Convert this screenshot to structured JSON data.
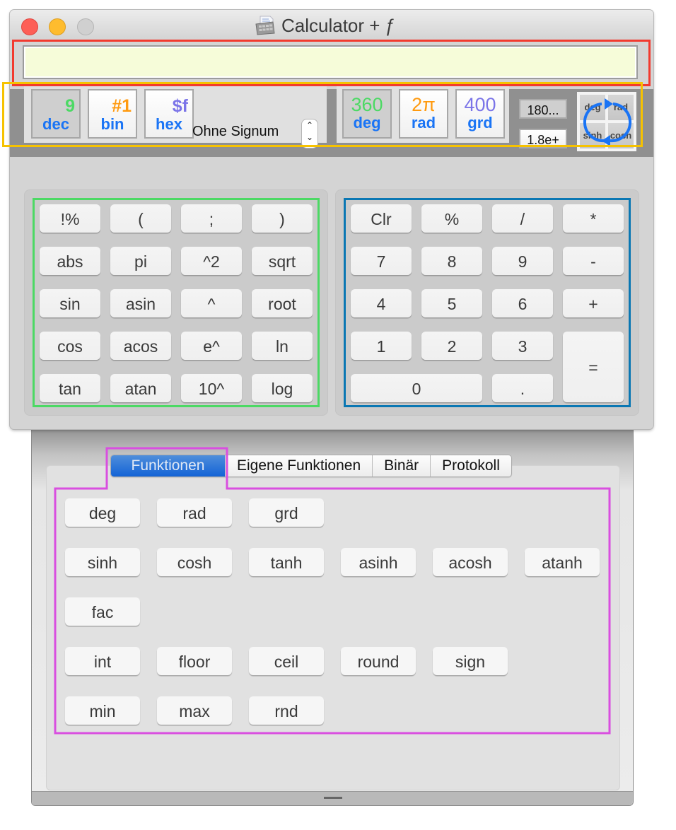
{
  "window": {
    "title": "Calculator + ƒ",
    "traffic_lights": [
      "close",
      "minimize",
      "zoom"
    ]
  },
  "display": {
    "value": ""
  },
  "number_modes": [
    {
      "id": "dec",
      "top": "9",
      "label": "dec",
      "top_color": "#4cd964",
      "selected": true
    },
    {
      "id": "bin",
      "top": "#1",
      "label": "bin",
      "top_color": "#ff9a0f",
      "selected": false
    },
    {
      "id": "hex",
      "top": "$f",
      "label": "hex",
      "top_color": "#7b74e8",
      "selected": false
    }
  ],
  "signum": {
    "selected": "Ohne Signum"
  },
  "angle_modes": [
    {
      "id": "deg",
      "top": "360",
      "label": "deg",
      "top_color": "#4cd964",
      "selected": true
    },
    {
      "id": "rad",
      "top": "2π",
      "label": "rad",
      "top_color": "#ff9a0f",
      "selected": false
    },
    {
      "id": "grd",
      "top": "400",
      "label": "grd",
      "top_color": "#7b74e8",
      "selected": false
    }
  ],
  "format_buttons": [
    {
      "id": "fixed",
      "label": "180...",
      "selected": true
    },
    {
      "id": "scientific",
      "label": "1.8e+",
      "selected": false
    }
  ],
  "rotate_buttons": {
    "labels": [
      "deg",
      "rad",
      "sinh",
      "cosh"
    ],
    "icon": "rotate-arrows-icon"
  },
  "function_keys": [
    [
      "!%",
      "(",
      ";",
      ")"
    ],
    [
      "abs",
      "pi",
      "^2",
      "sqrt"
    ],
    [
      "sin",
      "asin",
      "^",
      "root"
    ],
    [
      "cos",
      "acos",
      "e^",
      "ln"
    ],
    [
      "tan",
      "atan",
      "10^",
      "log"
    ]
  ],
  "numeric_keys": [
    [
      "Clr",
      "%",
      "/",
      "*"
    ],
    [
      "7",
      "8",
      "9",
      "-"
    ],
    [
      "4",
      "5",
      "6",
      "+"
    ],
    [
      "1",
      "2",
      "3",
      "="
    ],
    [
      "0",
      "."
    ]
  ],
  "drawer": {
    "tabs": [
      {
        "label": "Funktionen",
        "active": true
      },
      {
        "label": "Eigene Funktionen",
        "active": false
      },
      {
        "label": "Binär",
        "active": false
      },
      {
        "label": "Protokoll",
        "active": false
      }
    ],
    "function_rows": [
      [
        "deg",
        "rad",
        "grd"
      ],
      [
        "sinh",
        "cosh",
        "tanh",
        "asinh",
        "acosh",
        "atanh"
      ],
      [
        "fac"
      ],
      [
        "int",
        "floor",
        "ceil",
        "round",
        "sign"
      ],
      [
        "min",
        "max",
        "rnd"
      ]
    ]
  },
  "annotation_colors": {
    "display": "#f23a2f",
    "mode_bar": "#f6c200",
    "function_pad": "#4cd964",
    "numeric_pad": "#0a77b3",
    "drawer_functions": "#d94fe0"
  }
}
